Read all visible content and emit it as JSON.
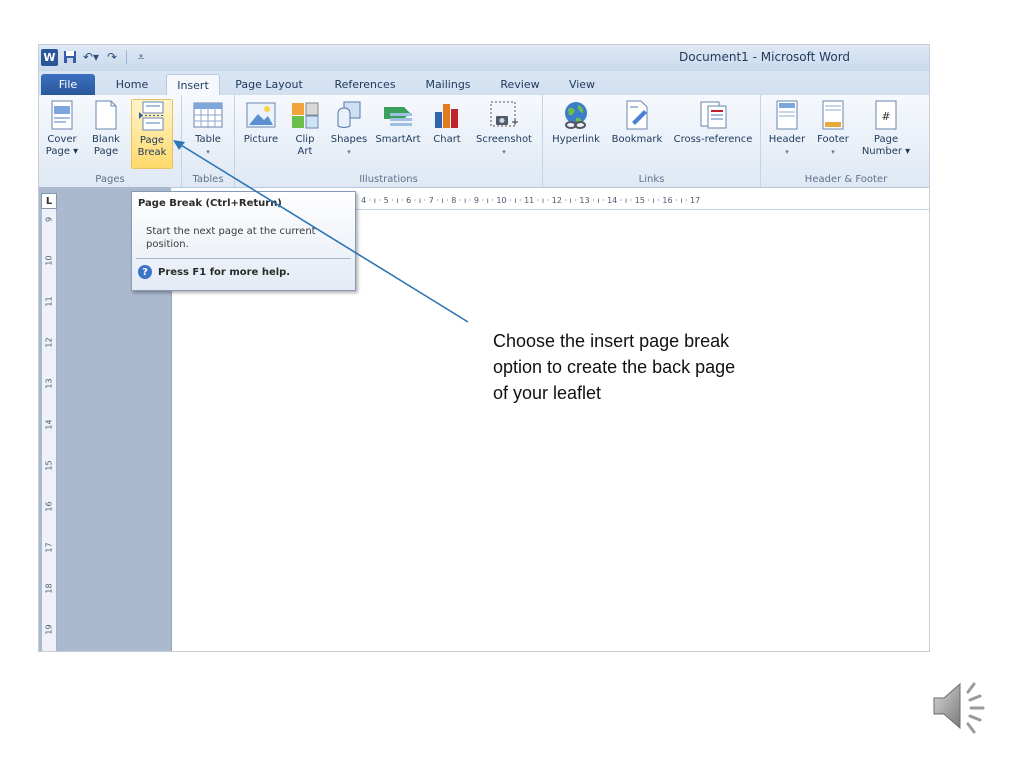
{
  "window": {
    "title": "Document1  -  Microsoft Word",
    "logo_letter": "W"
  },
  "tabs": [
    {
      "label": "File"
    },
    {
      "label": "Home"
    },
    {
      "label": "Insert"
    },
    {
      "label": "Page Layout"
    },
    {
      "label": "References"
    },
    {
      "label": "Mailings"
    },
    {
      "label": "Review"
    },
    {
      "label": "View"
    }
  ],
  "ribbon": {
    "groups": {
      "pages": "Pages",
      "tables": "Tables",
      "illustrations": "Illustrations",
      "links": "Links",
      "header_footer": "Header & Footer"
    },
    "buttons": {
      "cover_page": [
        "Cover",
        "Page"
      ],
      "blank_page": [
        "Blank",
        "Page"
      ],
      "page_break": [
        "Page",
        "Break"
      ],
      "table": "Table",
      "picture": "Picture",
      "clip_art": [
        "Clip",
        "Art"
      ],
      "shapes": "Shapes",
      "smartart": "SmartArt",
      "chart": "Chart",
      "screenshot": "Screenshot",
      "hyperlink": "Hyperlink",
      "bookmark": "Bookmark",
      "cross_reference": "Cross-reference",
      "header": "Header",
      "footer": "Footer",
      "page_number": [
        "Page",
        "Number"
      ]
    }
  },
  "ruler": {
    "vertical": [
      "9",
      "10",
      "11",
      "12",
      "13",
      "14",
      "15",
      "16",
      "17",
      "18",
      "19"
    ],
    "horizontal": "4 · ı · 5 · ı · 6 · ı · 7 · ı · 8 · ı · 9 · ı · 10 · ı · 11 · ı · 12 · ı · 13 · ı · 14 · ı · 15 · ı · 16 · ı · 17",
    "corner_mark": "L"
  },
  "tooltip": {
    "title": "Page Break (Ctrl+Return)",
    "body": "Start the next page at the current position.",
    "help": "Press F1 for more help."
  },
  "annotation": "Choose the insert page break option to create the back page of your leaflet",
  "colors": {
    "accent": "#2a579a",
    "arrow": "#2e75b6",
    "highlight": "#ffd96b"
  }
}
